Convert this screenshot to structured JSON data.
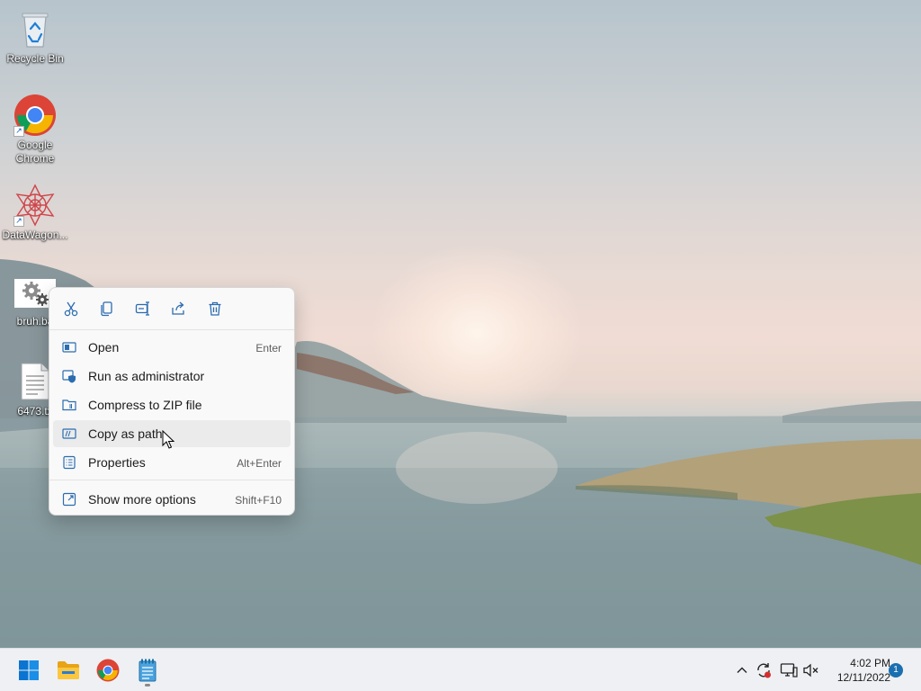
{
  "desktop": {
    "icons": [
      {
        "label": "Recycle Bin",
        "icon": "recycle-bin-icon"
      },
      {
        "label": "Google Chrome",
        "icon": "chrome-icon"
      },
      {
        "label": "DataWagon...",
        "icon": "datawagon-icon"
      },
      {
        "label": "bruh.ba",
        "icon": "batch-file-icon"
      },
      {
        "label": "6473.tx",
        "icon": "text-file-icon"
      }
    ]
  },
  "context_menu": {
    "quick_actions": [
      {
        "name": "Cut",
        "icon": "cut-icon"
      },
      {
        "name": "Copy",
        "icon": "copy-icon"
      },
      {
        "name": "Rename",
        "icon": "rename-icon"
      },
      {
        "name": "Share",
        "icon": "share-icon"
      },
      {
        "name": "Delete",
        "icon": "delete-icon"
      }
    ],
    "items": [
      {
        "label": "Open",
        "shortcut": "Enter",
        "icon": "open-icon"
      },
      {
        "label": "Run as administrator",
        "shortcut": "",
        "icon": "shield-icon"
      },
      {
        "label": "Compress to ZIP file",
        "shortcut": "",
        "icon": "zip-folder-icon"
      },
      {
        "label": "Copy as path",
        "shortcut": "",
        "icon": "copy-path-icon"
      },
      {
        "label": "Properties",
        "shortcut": "Alt+Enter",
        "icon": "properties-icon"
      },
      {
        "label": "Show more options",
        "shortcut": "Shift+F10",
        "icon": "more-options-icon"
      }
    ]
  },
  "taskbar": {
    "apps": [
      {
        "name": "Start",
        "icon": "windows-start-icon"
      },
      {
        "name": "File Explorer",
        "icon": "folder-icon"
      },
      {
        "name": "Google Chrome",
        "icon": "chrome-icon"
      },
      {
        "name": "Notepad",
        "icon": "notepad-icon"
      }
    ],
    "tray": {
      "time": "4:02 PM",
      "date": "12/11/2022",
      "notification_count": "1"
    }
  },
  "colors": {
    "accent": "#0078d4",
    "menu_background": "#f9f9f9",
    "taskbar_background": "#eef0f3"
  }
}
